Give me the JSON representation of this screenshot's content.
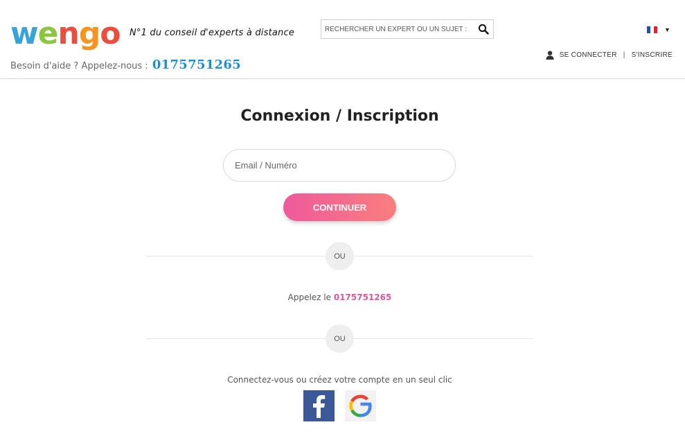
{
  "header": {
    "logo": {
      "letters": [
        "w",
        "e",
        "n",
        "g",
        "o"
      ],
      "colors": [
        "#36a3d9",
        "#8cc63f",
        "#e94e3f",
        "#f7941d",
        "#e94e3f"
      ]
    },
    "tagline": "N°1 du conseil d'experts à distance",
    "help_prefix": "Besoin d'aide ? Appelez-nous :",
    "help_phone": "0175751265",
    "search": {
      "placeholder": "RECHERCHER UN EXPERT OU UN SUJET :",
      "icon": "search-icon"
    },
    "language": {
      "flag": "fr",
      "icon": "chevron-down-icon"
    },
    "account": {
      "icon": "user-icon",
      "login_label": "SE CONNECTER",
      "separator": "|",
      "signup_label": "S'INSCRIRE"
    }
  },
  "main": {
    "title": "Connexion / Inscription",
    "email_placeholder": "Email / Numéro",
    "continue_label": "CONTINUER",
    "or_label_1": "OU",
    "call_prefix": "Appelez le",
    "call_phone": "0175751265",
    "or_label_2": "OU",
    "social_text": "Connectez-vous ou créez votre compte en un seul clic",
    "social": [
      {
        "name": "facebook",
        "icon": "facebook-icon"
      },
      {
        "name": "google",
        "icon": "google-icon"
      }
    ]
  },
  "colors": {
    "accent_pink": "#e0569a",
    "button_gradient": [
      "#ee5a9c",
      "#f97e7e"
    ],
    "phone_blue": "#1b8fd1",
    "facebook_blue": "#3b5998"
  }
}
